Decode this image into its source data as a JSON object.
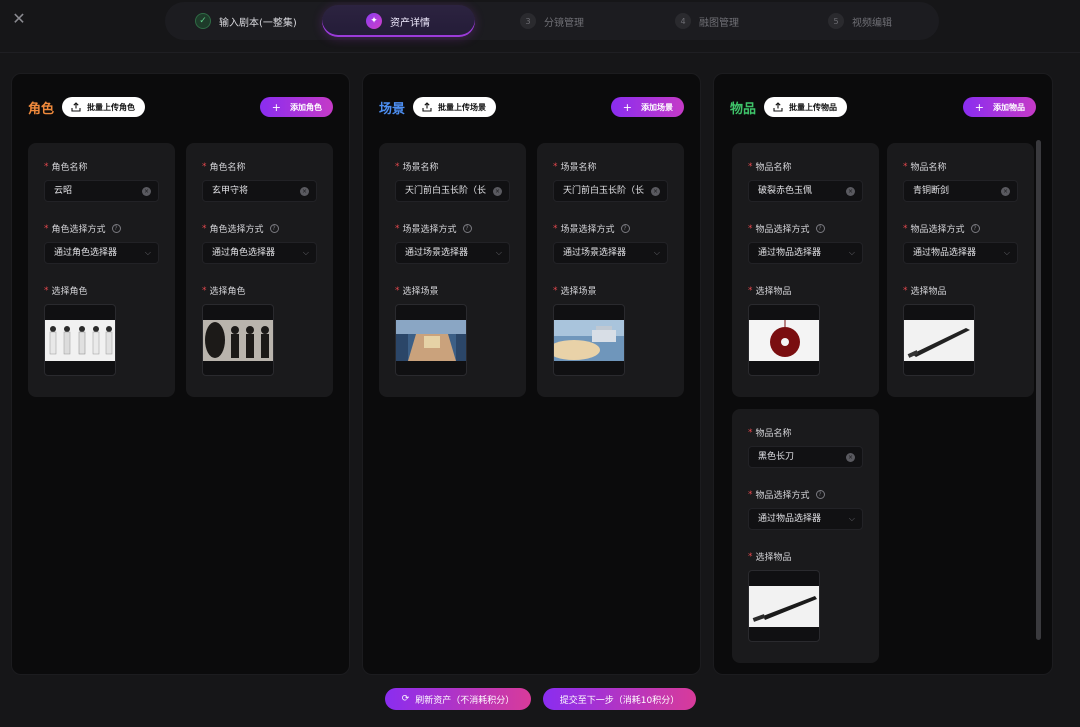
{
  "stepper": {
    "steps": [
      {
        "num": "✓",
        "label": "输入剧本(一整集)"
      },
      {
        "num": "✦",
        "label": "资产详情"
      },
      {
        "num": "3",
        "label": "分镜管理"
      },
      {
        "num": "4",
        "label": "融图管理"
      },
      {
        "num": "5",
        "label": "视频编辑"
      }
    ]
  },
  "common": {
    "required_mark": "*",
    "help_mark": "?",
    "clear_mark": "×",
    "chevron": "⌵",
    "add_plus": "+"
  },
  "panels": [
    {
      "title": "角色",
      "title_color": "#f08a3c",
      "upload_label": "批量上传角色",
      "add_label": "添加角色",
      "cards": [
        {
          "name_label": "角色名称",
          "name_value": "云昭",
          "method_label": "角色选择方式",
          "method_value": "通过角色选择器",
          "pick_label": "选择角色"
        },
        {
          "name_label": "角色名称",
          "name_value": "玄甲守将",
          "method_label": "角色选择方式",
          "method_value": "通过角色选择器",
          "pick_label": "选择角色"
        }
      ]
    },
    {
      "title": "场景",
      "title_color": "#4d8ef0",
      "upload_label": "批量上传场景",
      "add_label": "添加场景",
      "cards": [
        {
          "name_label": "场景名称",
          "name_value": "天门前白玉长阶（长",
          "method_label": "场景选择方式",
          "method_value": "通过场景选择器",
          "pick_label": "选择场景"
        },
        {
          "name_label": "场景名称",
          "name_value": "天门前白玉长阶（长",
          "method_label": "场景选择方式",
          "method_value": "通过场景选择器",
          "pick_label": "选择场景"
        }
      ]
    },
    {
      "title": "物品",
      "title_color": "#3fc46a",
      "upload_label": "批量上传物品",
      "add_label": "添加物品",
      "cards": [
        {
          "name_label": "物品名称",
          "name_value": "破裂赤色玉佩",
          "method_label": "物品选择方式",
          "method_value": "通过物品选择器",
          "pick_label": "选择物品"
        },
        {
          "name_label": "物品名称",
          "name_value": "青铜断剑",
          "method_label": "物品选择方式",
          "method_value": "通过物品选择器",
          "pick_label": "选择物品"
        },
        {
          "name_label": "物品名称",
          "name_value": "黑色长刀",
          "method_label": "物品选择方式",
          "method_value": "通过物品选择器",
          "pick_label": "选择物品"
        }
      ]
    }
  ],
  "footer": {
    "refresh_label": "刷新资产（不消耗积分）",
    "submit_label": "提交至下一步（消耗10积分）"
  },
  "colors": {
    "accent_start": "#8a2df0",
    "accent_end": "#c53ac7"
  }
}
